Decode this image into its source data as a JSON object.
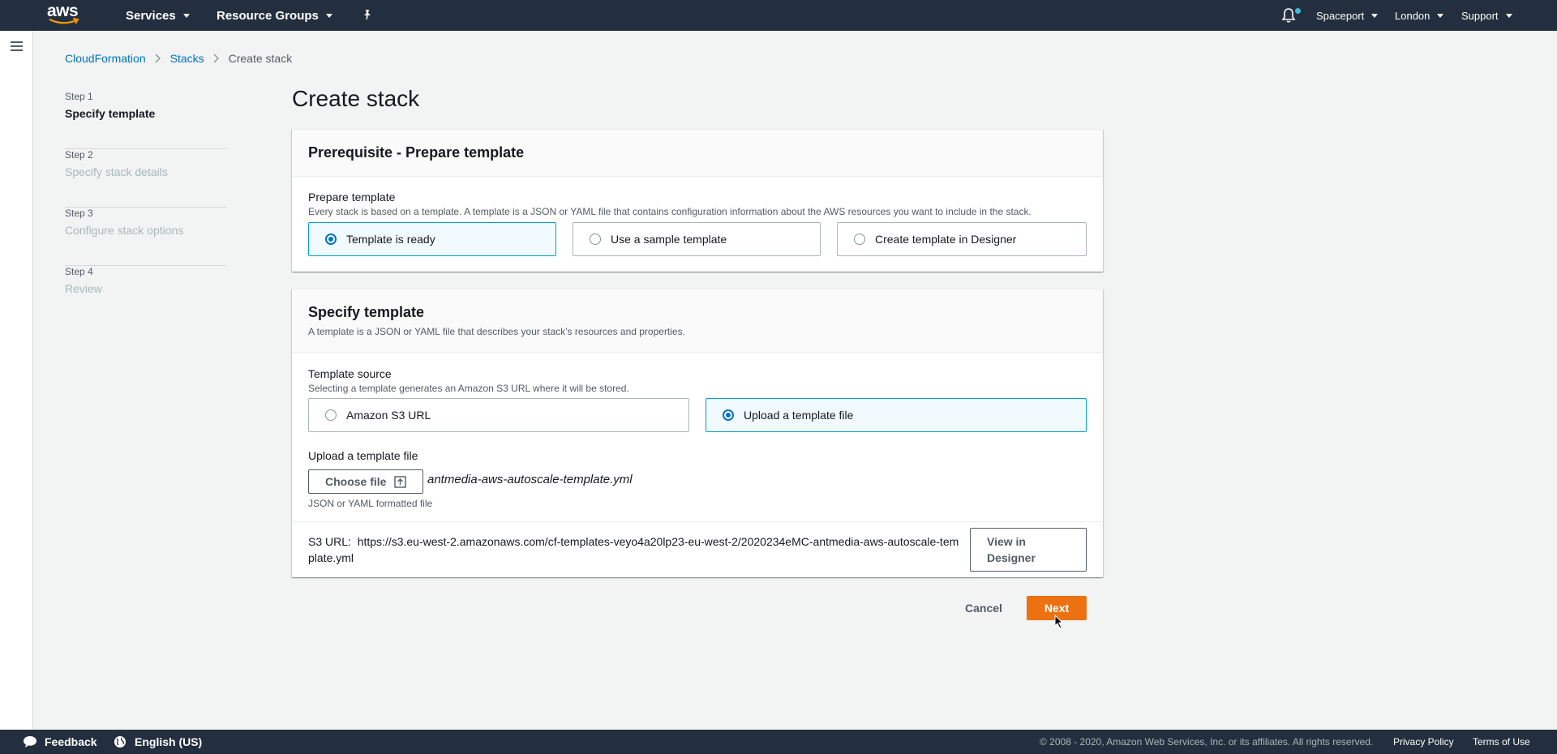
{
  "topnav": {
    "logo_text": "aws",
    "services": "Services",
    "resource_groups": "Resource Groups",
    "account": "Spaceport",
    "region": "London",
    "support": "Support"
  },
  "breadcrumb": {
    "items": [
      "CloudFormation",
      "Stacks",
      "Create stack"
    ]
  },
  "steps": [
    {
      "num": "Step 1",
      "title": "Specify template"
    },
    {
      "num": "Step 2",
      "title": "Specify stack details"
    },
    {
      "num": "Step 3",
      "title": "Configure stack options"
    },
    {
      "num": "Step 4",
      "title": "Review"
    }
  ],
  "page_title": "Create stack",
  "prerequisite": {
    "title": "Prerequisite - Prepare template",
    "label": "Prepare template",
    "description": "Every stack is based on a template. A template is a JSON or YAML file that contains configuration information about the AWS resources you want to include in the stack.",
    "options": [
      "Template is ready",
      "Use a sample template",
      "Create template in Designer"
    ],
    "selected": "Template is ready"
  },
  "specify": {
    "title": "Specify template",
    "description": "A template is a JSON or YAML file that describes your stack's resources and properties.",
    "source_label": "Template source",
    "source_description": "Selecting a template generates an Amazon S3 URL where it will be stored.",
    "options": [
      "Amazon S3 URL",
      "Upload a template file"
    ],
    "selected": "Upload a template file",
    "upload_label": "Upload a template file",
    "choose_file": "Choose file",
    "file_name": "antmedia-aws-autoscale-template.yml",
    "file_hint": "JSON or YAML formatted file",
    "s3_label": "S3 URL:",
    "s3_url": "https://s3.eu-west-2.amazonaws.com/cf-templates-veyo4a20lp23-eu-west-2/2020234eMC-antmedia-aws-autoscale-template.yml",
    "view_designer": "View in Designer"
  },
  "actions": {
    "cancel": "Cancel",
    "next": "Next"
  },
  "footer": {
    "feedback": "Feedback",
    "language": "English (US)",
    "copyright": "© 2008 - 2020, Amazon Web Services, Inc. or its affiliates. All rights reserved.",
    "privacy": "Privacy Policy",
    "terms": "Terms of Use"
  },
  "colors": {
    "nav_bg": "#232f3e",
    "link": "#0073bb",
    "primary": "#ec7211",
    "selected_border": "#00a1c9"
  },
  "icons": [
    "menu-icon",
    "pin-icon",
    "bell-icon",
    "chevron-right-icon",
    "upload-icon",
    "chat-bubble-icon",
    "globe-icon",
    "mouse-cursor-icon"
  ]
}
